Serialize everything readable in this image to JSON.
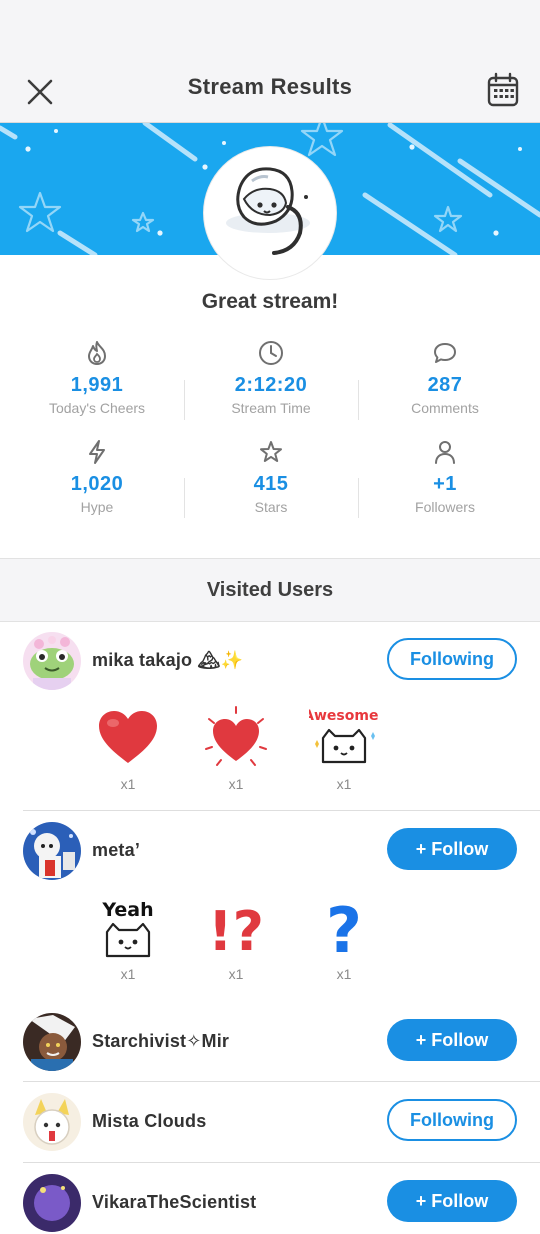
{
  "header": {
    "title": "Stream Results",
    "close_icon": "close-icon",
    "calendar_icon": "calendar-icon"
  },
  "banner": {
    "color": "#1aa7ef"
  },
  "message": "Great stream!",
  "stats": [
    {
      "icon": "flame-icon",
      "value": "1,991",
      "label": "Today's Cheers"
    },
    {
      "icon": "clock-icon",
      "value": "2:12:20",
      "label": "Stream Time"
    },
    {
      "icon": "comment-icon",
      "value": "287",
      "label": "Comments"
    },
    {
      "icon": "lightning-icon",
      "value": "1,020",
      "label": "Hype"
    },
    {
      "icon": "star-icon",
      "value": "415",
      "label": "Stars"
    },
    {
      "icon": "person-icon",
      "value": "+1",
      "label": "Followers"
    }
  ],
  "section": {
    "title": "Visited Users"
  },
  "users": [
    {
      "name": "mika takajo 🏔✨",
      "button": "Following",
      "stickers": [
        {
          "name": "heart-sticker",
          "count": "x1"
        },
        {
          "name": "sparkling-heart-sticker",
          "count": "x1"
        },
        {
          "name": "awesome-cat-sticker",
          "text": "Awesome!",
          "count": "x1"
        }
      ]
    },
    {
      "name": "meta’",
      "button": "+ Follow",
      "stickers": [
        {
          "name": "yeah-cat-sticker",
          "text": "Yeah",
          "count": "x1"
        },
        {
          "name": "exclamation-question-sticker",
          "text": "!?",
          "count": "x1"
        },
        {
          "name": "question-mark-sticker",
          "text": "?",
          "count": "x1"
        }
      ]
    },
    {
      "name": "Starchivist✧Mir",
      "button": "+ Follow"
    },
    {
      "name": "Mista Clouds",
      "button": "Following"
    },
    {
      "name": "VikaraTheScientist",
      "button": "+ Follow"
    }
  ],
  "colors": {
    "accent": "#1a8fe3",
    "heart": "#e0393f"
  }
}
